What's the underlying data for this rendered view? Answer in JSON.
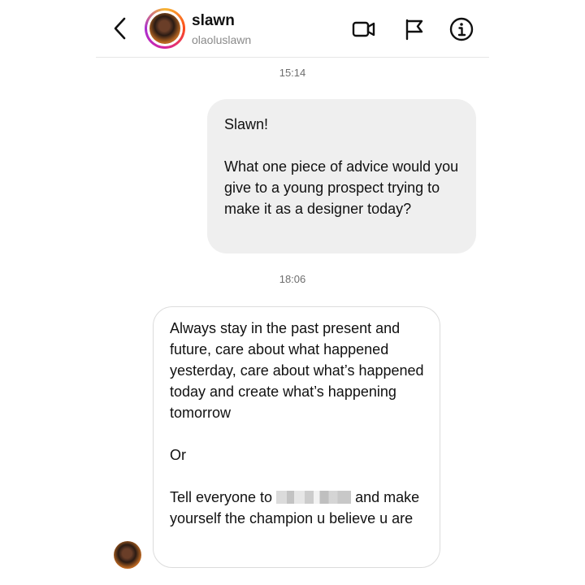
{
  "header": {
    "name": "slawn",
    "username": "olaoluslawn",
    "icons": [
      "chevron-left-icon",
      "video-call-icon",
      "flag-icon",
      "info-icon"
    ]
  },
  "messages": [
    {
      "timestamp": "15:14",
      "direction": "outgoing",
      "paragraphs": [
        "Slawn!",
        "What one piece of advice would you give to a young prospect trying to make it as a designer today?"
      ]
    },
    {
      "timestamp": "18:06",
      "direction": "incoming",
      "paragraphs": [
        "Always stay in the past present and future, care about what happened yesterday, care about what’s happened today and create what’s happening tomorrow",
        "Or"
      ],
      "last_paragraph": {
        "before": "Tell everyone to",
        "after": "and make yourself the champion u believe u are"
      }
    }
  ],
  "colors": {
    "outgoing_bubble": "#efefef",
    "incoming_border": "#dcdcdc",
    "timestamp_text": "#6e6e6e",
    "username_text": "#8a8a8a"
  }
}
